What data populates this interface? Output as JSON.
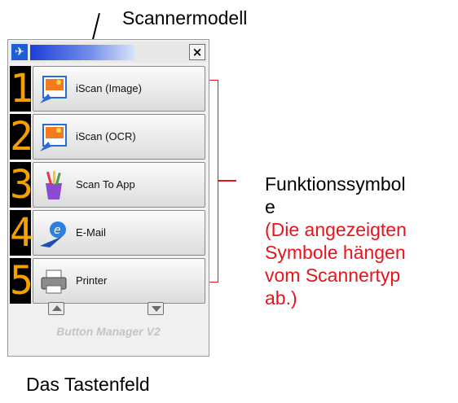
{
  "callouts": {
    "scanner_model": "Scannermodell",
    "functions_label": "Funktionssymbol\ne",
    "functions_note": "(Die angezeigten\nSymbole hängen\nvom Scannertyp\nab.)",
    "keypad": "Das Tastenfeld"
  },
  "panel": {
    "close_symbol": "×",
    "app_icon_glyph": "✈",
    "buttons": [
      {
        "digit": "1",
        "label": "iScan (Image)",
        "icon": "iscan-image-icon"
      },
      {
        "digit": "2",
        "label": "iScan (OCR)",
        "icon": "iscan-ocr-icon"
      },
      {
        "digit": "3",
        "label": "Scan To App",
        "icon": "scan-to-app-icon"
      },
      {
        "digit": "4",
        "label": "E-Mail",
        "icon": "email-icon"
      },
      {
        "digit": "5",
        "label": "Printer",
        "icon": "printer-icon"
      }
    ],
    "footer": "Button Manager V2"
  },
  "colors": {
    "callout_accent": "#e8141b",
    "digit_color": "#f3a100",
    "title_bar_gradient_start": "#1d3fd8"
  }
}
